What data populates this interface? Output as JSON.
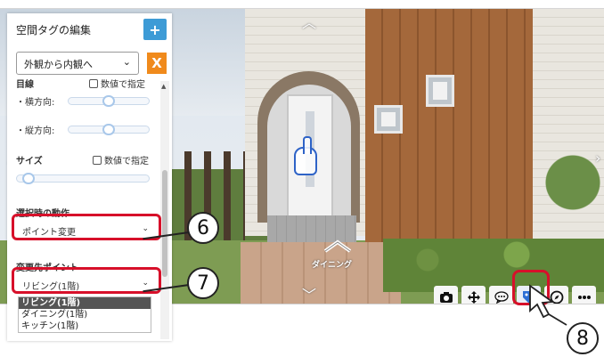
{
  "panel": {
    "title": "空間タグの編集",
    "add_button": "+",
    "view_select": "外観から内観へ",
    "close_button": "X",
    "size_group_label": "目線",
    "numeric_input_label": "数値で指定",
    "horizontal_label": "・横方向:",
    "vertical_label": "・縦方向:",
    "size_label": "サイズ",
    "size_numeric_label": "数値で指定",
    "action_label": "選択時の動作",
    "action_value": "ポイント変更",
    "target_label": "変更先ポイント",
    "target_value": "リビング(1階)",
    "target_options": [
      "リビング(1階)",
      "ダイニング(1階)",
      "キッチン(1階)"
    ]
  },
  "viewport": {
    "marker_label": "ダイニング"
  },
  "toolbar": {
    "buttons": [
      "camera-icon",
      "move-icon",
      "comment-icon",
      "tag-icon",
      "compass-icon",
      "more-icon"
    ]
  },
  "callouts": {
    "six": "6",
    "seven": "7",
    "eight": "8"
  },
  "colors": {
    "highlight": "#d7102a",
    "add_button": "#3d9bd6",
    "close_button": "#f08a1c",
    "tag_icon": "#2e6fd6"
  }
}
